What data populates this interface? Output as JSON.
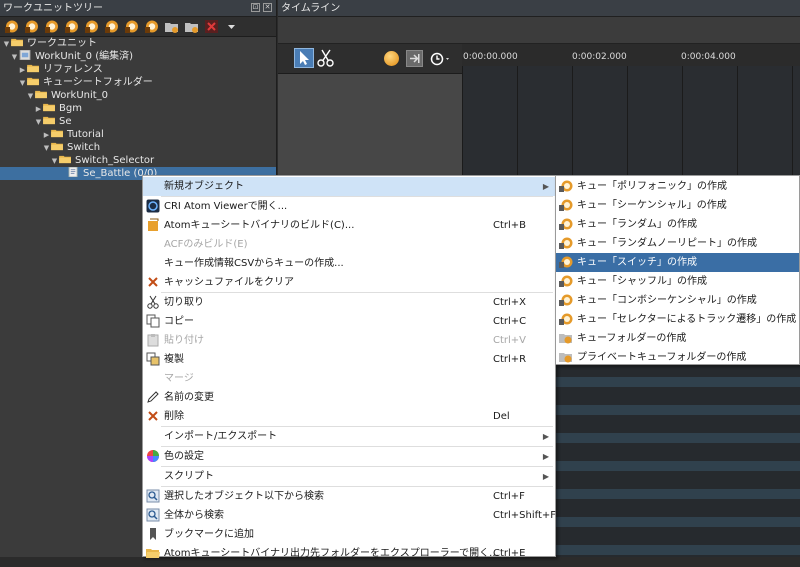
{
  "left_panel": {
    "title": "ワークユニットツリー",
    "tree": [
      {
        "label": "ワークユニット",
        "indent": 0,
        "arrow": "▼",
        "icon": "folder",
        "selected": false
      },
      {
        "label": "WorkUnit_0 (編集済)",
        "indent": 1,
        "arrow": "▼",
        "icon": "workunit",
        "selected": false
      },
      {
        "label": "リファレンス",
        "indent": 2,
        "arrow": "▶",
        "icon": "folder",
        "selected": false
      },
      {
        "label": "キューシートフォルダー",
        "indent": 2,
        "arrow": "▼",
        "icon": "folder",
        "selected": false
      },
      {
        "label": "WorkUnit_0",
        "indent": 3,
        "arrow": "▼",
        "icon": "folder",
        "selected": false
      },
      {
        "label": "Bgm",
        "indent": 4,
        "arrow": "▶",
        "icon": "folder",
        "selected": false
      },
      {
        "label": "Se",
        "indent": 4,
        "arrow": "▼",
        "icon": "folder",
        "selected": false
      },
      {
        "label": "Tutorial",
        "indent": 5,
        "arrow": "▶",
        "icon": "folder",
        "selected": false
      },
      {
        "label": "Switch",
        "indent": 5,
        "arrow": "▼",
        "icon": "folder",
        "selected": false
      },
      {
        "label": "Switch_Selector",
        "indent": 6,
        "arrow": "▼",
        "icon": "folder",
        "selected": false
      },
      {
        "label": "Se_Battle (0/0)",
        "indent": 7,
        "arrow": "",
        "icon": "cuesheet",
        "selected": true
      }
    ]
  },
  "timeline": {
    "title": "タイムライン",
    "ticks": [
      "0:00:00.000",
      "0:00:02.000",
      "0:00:04.000"
    ]
  },
  "context_menu": {
    "items": [
      {
        "label": "新規オブジェクト",
        "shortcut": "",
        "icon": "none",
        "disabled": false,
        "submenu": true,
        "highlight": true
      },
      {
        "sep": true
      },
      {
        "label": "CRI Atom Viewerで開く...",
        "shortcut": "",
        "icon": "viewer-icon",
        "disabled": false
      },
      {
        "label": "Atomキューシートバイナリのビルド(C)...",
        "shortcut": "Ctrl+B",
        "icon": "build-icon",
        "disabled": false
      },
      {
        "label": "ACFのみビルド(E)",
        "shortcut": "",
        "icon": "none",
        "disabled": true
      },
      {
        "label": "キュー作成情報CSVからキューの作成...",
        "shortcut": "",
        "icon": "none",
        "disabled": false
      },
      {
        "label": "キャッシュファイルをクリア",
        "shortcut": "",
        "icon": "clear-icon",
        "disabled": false
      },
      {
        "sep": true
      },
      {
        "label": "切り取り",
        "shortcut": "Ctrl+X",
        "icon": "cut-icon",
        "disabled": false
      },
      {
        "label": "コピー",
        "shortcut": "Ctrl+C",
        "icon": "copy-icon",
        "disabled": false
      },
      {
        "label": "貼り付け",
        "shortcut": "Ctrl+V",
        "icon": "paste-icon",
        "disabled": true
      },
      {
        "label": "複製",
        "shortcut": "Ctrl+R",
        "icon": "duplicate-icon",
        "disabled": false
      },
      {
        "label": "マージ",
        "shortcut": "",
        "icon": "none",
        "disabled": true
      },
      {
        "label": "名前の変更",
        "shortcut": "",
        "icon": "rename-icon",
        "disabled": false
      },
      {
        "label": "削除",
        "shortcut": "Del",
        "icon": "delete-icon",
        "disabled": false
      },
      {
        "sep": true
      },
      {
        "label": "インポート/エクスポート",
        "shortcut": "",
        "icon": "none",
        "disabled": false,
        "submenu": true
      },
      {
        "sep": true
      },
      {
        "label": "色の設定",
        "shortcut": "",
        "icon": "color-icon",
        "disabled": false,
        "submenu": true
      },
      {
        "sep": true
      },
      {
        "label": "スクリプト",
        "shortcut": "",
        "icon": "none",
        "disabled": false,
        "submenu": true
      },
      {
        "sep": true
      },
      {
        "label": "選択したオブジェクト以下から検索",
        "shortcut": "Ctrl+F",
        "icon": "search-icon",
        "disabled": false
      },
      {
        "label": "全体から検索",
        "shortcut": "Ctrl+Shift+F",
        "icon": "search-all-icon",
        "disabled": false
      },
      {
        "label": "ブックマークに追加",
        "shortcut": "",
        "icon": "bookmark-icon",
        "disabled": false
      },
      {
        "label": "Atomキューシートバイナリ出力先フォルダーをエクスプローラーで開く...",
        "shortcut": "Ctrl+E",
        "icon": "folder-open-icon",
        "disabled": false
      }
    ]
  },
  "submenu": {
    "items": [
      {
        "label": "キュー「ポリフォニック」の作成",
        "icon": "cue-icon",
        "highlight": false
      },
      {
        "label": "キュー「シーケンシャル」の作成",
        "icon": "cue-icon",
        "highlight": false
      },
      {
        "label": "キュー「ランダム」の作成",
        "icon": "cue-icon",
        "highlight": false
      },
      {
        "label": "キュー「ランダムノーリピート」の作成",
        "icon": "cue-icon",
        "highlight": false
      },
      {
        "label": "キュー「スイッチ」の作成",
        "icon": "cue-icon",
        "highlight": true
      },
      {
        "label": "キュー「シャッフル」の作成",
        "icon": "cue-icon",
        "highlight": false
      },
      {
        "label": "キュー「コンボシーケンシャル」の作成",
        "icon": "cue-icon",
        "highlight": false
      },
      {
        "label": "キュー「セレクターによるトラック遷移」の作成",
        "icon": "cue-icon",
        "highlight": false
      },
      {
        "label": "キューフォルダーの作成",
        "icon": "cue-folder-icon",
        "highlight": false
      },
      {
        "label": "プライベートキューフォルダーの作成",
        "icon": "cue-folder-icon",
        "highlight": false
      }
    ]
  }
}
